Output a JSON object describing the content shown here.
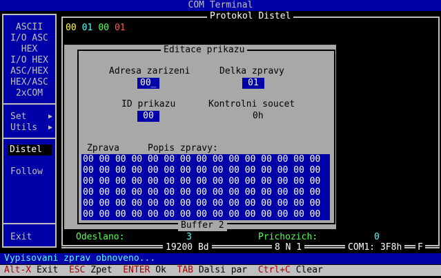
{
  "window_title": "COM Terminal",
  "menu": {
    "items_top": [
      "ASCII",
      "I/O ASC",
      "HEX",
      "I/O HEX",
      "ASC/HEX",
      "HEX/ASC",
      "2xCOM"
    ],
    "set": "Set",
    "utils": "Utils",
    "distel": "Distel",
    "follow": "Follow",
    "exit": "Exit",
    "arrow": "▶"
  },
  "main_title": "Protokol Distel",
  "hex_preview": [
    {
      "text": "00",
      "color": "#ffff55"
    },
    {
      "text": "01",
      "color": "#55ffff"
    },
    {
      "text": "00",
      "color": "#55ff55"
    },
    {
      "text": "01",
      "color": "#ff5555"
    }
  ],
  "dialog": {
    "title": "Editace prikazu",
    "adresa_label": "Adresa zarizeni",
    "adresa_value": "00_",
    "delka_label": "Delka zpravy",
    "delka_value": "01",
    "id_label": "ID prikazu",
    "id_value": "00",
    "kontrolni_label": "Kontrolni soucet",
    "kontrolni_value": "0h",
    "zprava_label": "Zprava",
    "popis_label": "Popis zpravy:",
    "grid_rows": [
      "00 00 00 00 00 00 00 00 00 00 00 00 00 00 00",
      "00 00 00 00 00 00 00 00 00 00 00 00 00 00 00",
      "00 00 00 00 00 00 00 00 00 00 00 00 00 00 00",
      "00 00 00 00 00 00 00 00 00 00 00 00 00 00 00",
      "00 00 00 00 00 00 00 00 00 00 00 00 00 00 00",
      "00 00 00 00 00 00 00 00 00 00 00 00 00 00 00"
    ],
    "footer": "Buffer 2"
  },
  "stats": {
    "odeslano_label": "Odeslano:",
    "odeslano_value": "3",
    "prichozich_label": "Prichozich:",
    "prichozich_value": "0"
  },
  "port": {
    "baud": "19200 Bd",
    "frame": "8 N 1",
    "port": "COM1: 3F8h",
    "flow": "F"
  },
  "info_message": "Vypisovani zprav obnoveno...",
  "hotkeys": [
    {
      "key": "Alt-X",
      "label": "Exit"
    },
    {
      "key": "ESC",
      "label": "Zpet"
    },
    {
      "key": "ENTER",
      "label": "Ok"
    },
    {
      "key": "TAB",
      "label": "Dalsi par"
    },
    {
      "key": "Ctrl+C",
      "label": "Clear"
    }
  ]
}
